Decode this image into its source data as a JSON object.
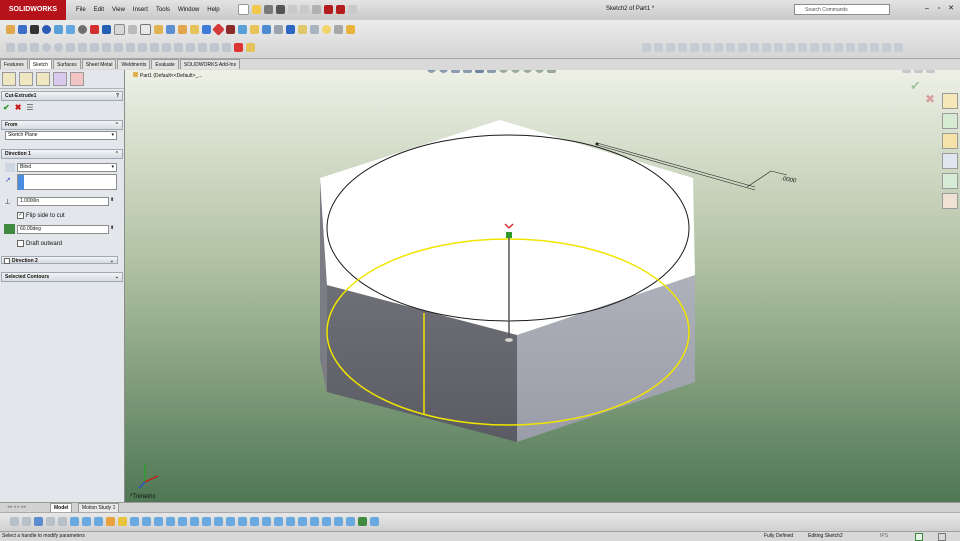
{
  "app": {
    "logo": "SOLIDWORKS",
    "title": "Sketch2 of Part1 *"
  },
  "menu": [
    "File",
    "Edit",
    "View",
    "Insert",
    "Tools",
    "Window",
    "Help"
  ],
  "search": {
    "placeholder": "Search Commands"
  },
  "tabs": [
    "Features",
    "Sketch",
    "Surfaces",
    "Sheet Metal",
    "Weldments",
    "Evaluate",
    "SOLIDWORKS Add-Ins"
  ],
  "active_tab": "Sketch",
  "tree_header": "Part1 (Default<<Default>_...",
  "feature": {
    "name": "Cut-Extrude1",
    "from_label": "From",
    "from_value": "Sketch Plane",
    "direction1_label": "Direction 1",
    "end_condition": "Blind",
    "depth": "1.0000in",
    "flip_side_label": "Flip side to cut",
    "flip_side_checked": true,
    "draft_angle": "60.00deg",
    "draft_outward_label": "Draft outward",
    "draft_outward_checked": false,
    "direction2_label": "Direction 2",
    "selected_contours_label": "Selected Contours"
  },
  "viewport": {
    "view_label": "*Trimetric",
    "dimension_text": ".0000"
  },
  "bottom_tabs": [
    "Model",
    "Motion Study 1"
  ],
  "status": {
    "message": "Select a handle to modify parameters",
    "state": "Fully Defined",
    "mode": "Editing Sketch2",
    "units": "IPS"
  },
  "colors": {
    "logo_red": "#b5121b",
    "yellow_contour": "#f0e500",
    "accept_green": "#2e9a2e",
    "cancel_red": "#c81818"
  }
}
